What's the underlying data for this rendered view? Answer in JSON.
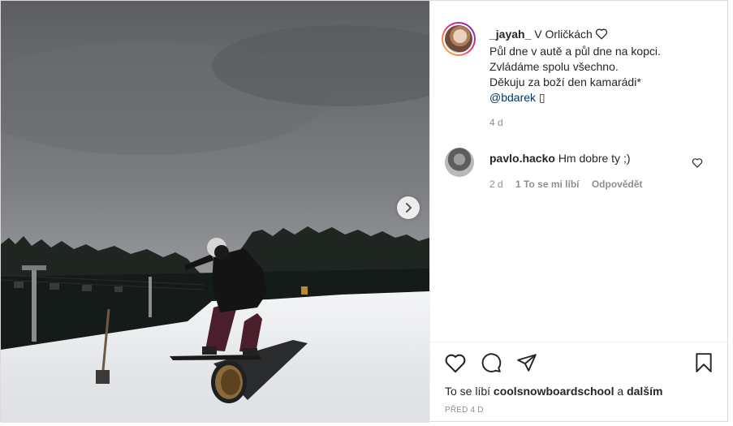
{
  "post": {
    "caption": {
      "username": "_jayah_",
      "location": "V Orličkách",
      "lines": [
        "Půl dne v autě a půl dne na kopci.",
        "Zvládáme spolu všechno.",
        "Děkuju za boží den kamarádi*"
      ],
      "mention": "@bdarek",
      "trailing_glyph": "▯",
      "time": "4 d"
    },
    "comment": {
      "username": "pavlo.hacko",
      "text": "Hm dobre ty ;)",
      "time": "2 d",
      "likes": "1 To se mi líbí",
      "reply": "Odpovědět"
    },
    "likes": {
      "prefix": "To se líbí",
      "user": "coolsnowboardschool",
      "joiner": "a",
      "others": "dalším"
    },
    "date": "PŘED 4 D",
    "icons": {
      "like": "heart-icon",
      "comment": "comment-bubble-icon",
      "share": "paper-plane-icon",
      "save": "bookmark-icon",
      "carousel_next": "chevron-right-icon",
      "location_like": "heart-outline-icon"
    }
  }
}
